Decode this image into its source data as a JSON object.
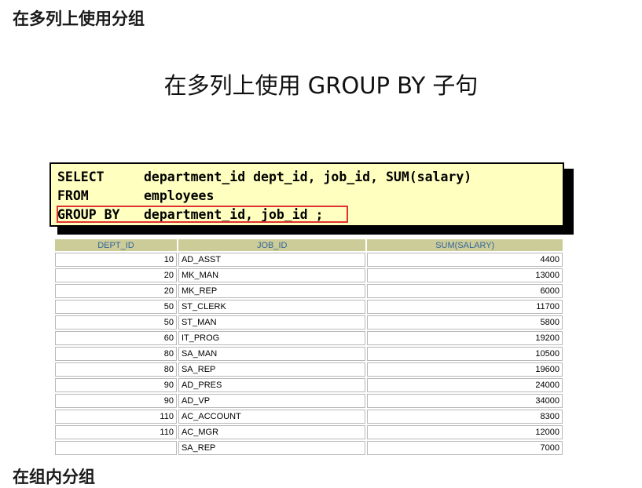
{
  "page_heading": "在多列上使用分组",
  "slide_title": "在多列上使用 GROUP BY 子句",
  "sql": {
    "line1_kw": "SELECT",
    "line1_rest": "department_id dept_id, job_id, SUM(salary)",
    "line2_kw": "FROM",
    "line2_rest": "employees",
    "line3_kw": "GROUP BY",
    "line3_rest": "department_id, job_id",
    "line3_end": " ;"
  },
  "table": {
    "headers": [
      "DEPT_ID",
      "JOB_ID",
      "SUM(SALARY)"
    ],
    "rows": [
      {
        "dept": "10",
        "job": "AD_ASST",
        "sum": "4400"
      },
      {
        "dept": "20",
        "job": "MK_MAN",
        "sum": "13000"
      },
      {
        "dept": "20",
        "job": "MK_REP",
        "sum": "6000"
      },
      {
        "dept": "50",
        "job": "ST_CLERK",
        "sum": "11700"
      },
      {
        "dept": "50",
        "job": "ST_MAN",
        "sum": "5800"
      },
      {
        "dept": "60",
        "job": "IT_PROG",
        "sum": "19200"
      },
      {
        "dept": "80",
        "job": "SA_MAN",
        "sum": "10500"
      },
      {
        "dept": "80",
        "job": "SA_REP",
        "sum": "19600"
      },
      {
        "dept": "90",
        "job": "AD_PRES",
        "sum": "24000"
      },
      {
        "dept": "90",
        "job": "AD_VP",
        "sum": "34000"
      },
      {
        "dept": "110",
        "job": "AC_ACCOUNT",
        "sum": "8300"
      },
      {
        "dept": "110",
        "job": "AC_MGR",
        "sum": "12000"
      },
      {
        "dept": "",
        "job": "SA_REP",
        "sum": "7000"
      }
    ]
  },
  "next_heading": "在组内分组"
}
